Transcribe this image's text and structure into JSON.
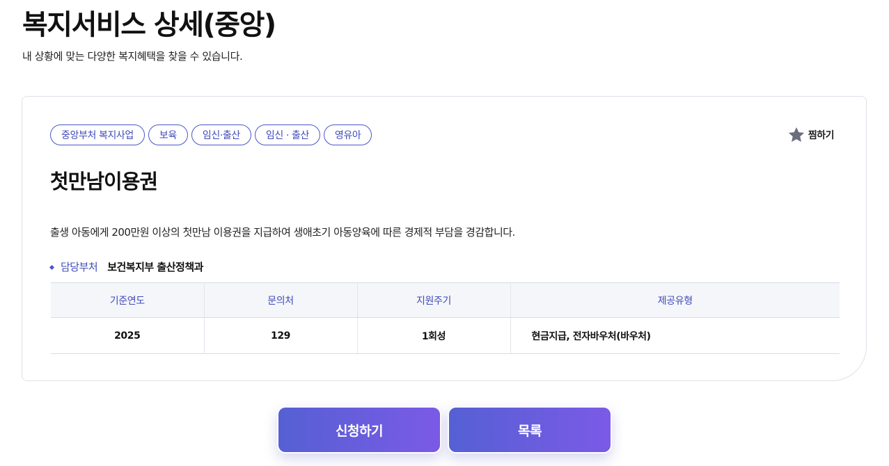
{
  "header": {
    "title": "복지서비스 상세(중앙)",
    "subtitle": "내 상황에 맞는 다양한 복지혜택을 찾을 수 있습니다."
  },
  "service": {
    "tags": [
      "중앙부처 복지사업",
      "보육",
      "임신·출산",
      "임신 · 출산",
      "영유아"
    ],
    "bookmark": {
      "icon": "star-icon",
      "label": "찜하기"
    },
    "name": "첫만남이용권",
    "description": "출생 아동에게 200만원 이상의 첫만남 이용권을 지급하여 생애초기 아동양육에 따른 경제적 부담을 경감합니다.",
    "department": {
      "label": "담당부처",
      "value": "보건복지부 출산정책과"
    },
    "table": {
      "headers": [
        "기준연도",
        "문의처",
        "지원주기",
        "제공유형"
      ],
      "row": [
        "2025",
        "129",
        "1회성",
        "현금지급, 전자바우처(바우처)"
      ]
    }
  },
  "actions": {
    "apply_label": "신청하기",
    "list_label": "목록"
  },
  "colors": {
    "accent": "#3f4bb8",
    "button_gradient_start": "#5560d4",
    "button_gradient_end": "#7b5ae6",
    "star": "#6b6f7d"
  }
}
